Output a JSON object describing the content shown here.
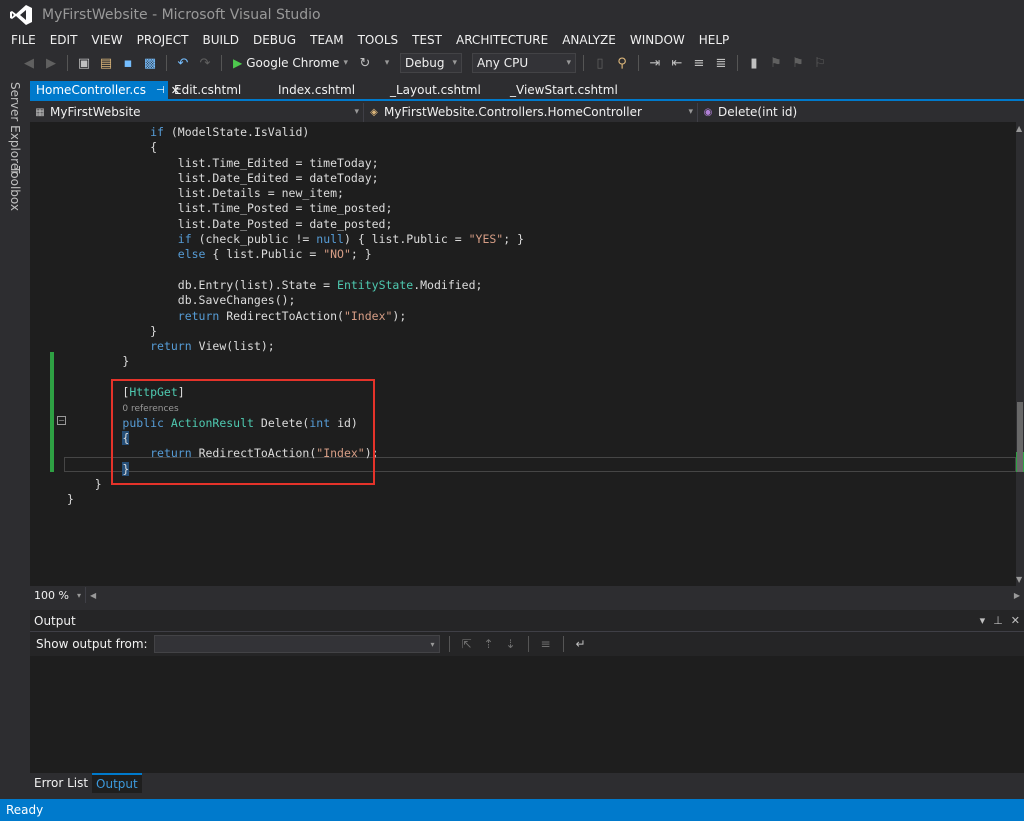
{
  "window": {
    "title": "MyFirstWebsite - Microsoft Visual Studio"
  },
  "menu": [
    "FILE",
    "EDIT",
    "VIEW",
    "PROJECT",
    "BUILD",
    "DEBUG",
    "TEAM",
    "TOOLS",
    "TEST",
    "ARCHITECTURE",
    "ANALYZE",
    "WINDOW",
    "HELP"
  ],
  "toolbar": {
    "run_target": "Google Chrome",
    "configuration": "Debug",
    "platform": "Any CPU"
  },
  "side_tabs": {
    "server_explorer": "Server Explorer",
    "toolbox": "Toolbox"
  },
  "doc_tabs": [
    {
      "label": "HomeController.cs",
      "active": true
    },
    {
      "label": "Edit.cshtml",
      "active": false
    },
    {
      "label": "Index.cshtml",
      "active": false
    },
    {
      "label": "_Layout.cshtml",
      "active": false
    },
    {
      "label": "_ViewStart.cshtml",
      "active": false
    }
  ],
  "nav": {
    "project": "MyFirstWebsite",
    "class": "MyFirstWebsite.Controllers.HomeController",
    "member": "Delete(int id)"
  },
  "code_lines": [
    [
      {
        "t": "            "
      },
      {
        "t": "if",
        "k": "kw"
      },
      {
        "t": " (ModelState.IsValid)"
      }
    ],
    [
      {
        "t": "            {"
      }
    ],
    [
      {
        "t": "                list.Time_Edited = timeToday;"
      }
    ],
    [
      {
        "t": "                list.Date_Edited = dateToday;"
      }
    ],
    [
      {
        "t": "                list.Details = new_item;"
      }
    ],
    [
      {
        "t": "                list.Time_Posted = time_posted;"
      }
    ],
    [
      {
        "t": "                list.Date_Posted = date_posted;"
      }
    ],
    [
      {
        "t": "                "
      },
      {
        "t": "if",
        "k": "kw"
      },
      {
        "t": " (check_public != "
      },
      {
        "t": "null",
        "k": "kw"
      },
      {
        "t": ") { list.Public = "
      },
      {
        "t": "\"YES\"",
        "k": "str"
      },
      {
        "t": "; }"
      }
    ],
    [
      {
        "t": "                "
      },
      {
        "t": "else",
        "k": "kw"
      },
      {
        "t": " { list.Public = "
      },
      {
        "t": "\"NO\"",
        "k": "str"
      },
      {
        "t": "; }"
      }
    ],
    [
      {
        "t": ""
      }
    ],
    [
      {
        "t": "                db.Entry(list).State = "
      },
      {
        "t": "EntityState",
        "k": "ty"
      },
      {
        "t": ".Modified;"
      }
    ],
    [
      {
        "t": "                db.SaveChanges();"
      }
    ],
    [
      {
        "t": "                "
      },
      {
        "t": "return",
        "k": "kw"
      },
      {
        "t": " RedirectToAction("
      },
      {
        "t": "\"Index\"",
        "k": "str"
      },
      {
        "t": ");"
      }
    ],
    [
      {
        "t": "            }"
      }
    ],
    [
      {
        "t": "            "
      },
      {
        "t": "return",
        "k": "kw"
      },
      {
        "t": " View(list);"
      }
    ],
    [
      {
        "t": "        }"
      }
    ],
    [
      {
        "t": ""
      }
    ],
    [
      {
        "t": "        ["
      },
      {
        "t": "HttpGet",
        "k": "ty"
      },
      {
        "t": "]"
      }
    ],
    [
      {
        "t": "        "
      },
      {
        "t": "0 references",
        "k": "ref"
      }
    ],
    [
      {
        "t": "        "
      },
      {
        "t": "public",
        "k": "kw"
      },
      {
        "t": " "
      },
      {
        "t": "ActionResult",
        "k": "ty"
      },
      {
        "t": " Delete("
      },
      {
        "t": "int",
        "k": "kw"
      },
      {
        "t": " id)"
      }
    ],
    [
      {
        "t": "        "
      },
      {
        "t": "{",
        "k": "brace-hl"
      }
    ],
    [
      {
        "t": "            "
      },
      {
        "t": "return",
        "k": "kw"
      },
      {
        "t": " RedirectToAction("
      },
      {
        "t": "\"Index\"",
        "k": "str"
      },
      {
        "t": ");"
      }
    ],
    [
      {
        "t": "        "
      },
      {
        "t": "}",
        "k": "brace-hl"
      }
    ],
    [
      {
        "t": "    }"
      }
    ],
    [
      {
        "t": "}"
      }
    ]
  ],
  "zoom": "100 %",
  "output": {
    "title": "Output",
    "show_from_label": "Show output from:",
    "show_from_value": ""
  },
  "bottom_tabs": [
    {
      "label": "Error List",
      "active": false
    },
    {
      "label": "Output",
      "active": true
    }
  ],
  "status": "Ready",
  "colors": {
    "accent": "#007acc",
    "highlight_box": "#e5332a",
    "change_margin": "#2ea043"
  }
}
